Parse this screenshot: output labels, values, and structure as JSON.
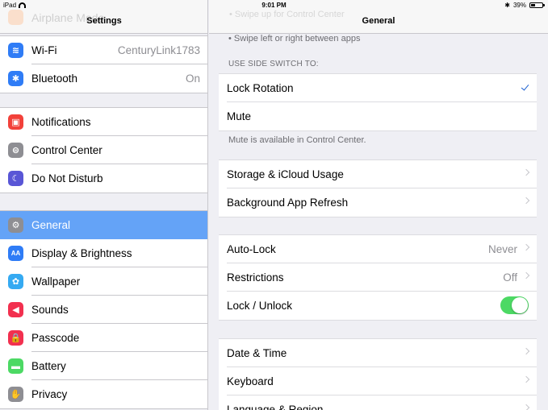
{
  "status_bar": {
    "carrier": "iPad",
    "time": "9:01 PM",
    "bluetooth_symbol": "✱",
    "battery_text": "39%",
    "battery_level": 0.39
  },
  "left": {
    "title": "Settings",
    "ghost_item": "Airplane Mode",
    "groups": [
      [
        {
          "label": "Wi-Fi",
          "value": "CenturyLink1783",
          "icon": "wifi-icon",
          "color": "#2f7cf6",
          "glyph": "≋"
        },
        {
          "label": "Bluetooth",
          "value": "On",
          "icon": "bluetooth-icon",
          "color": "#2f7cf6",
          "glyph": "✱"
        }
      ],
      [
        {
          "label": "Notifications",
          "value": "",
          "icon": "notifications-icon",
          "color": "#f2413a",
          "glyph": "▣"
        },
        {
          "label": "Control Center",
          "value": "",
          "icon": "control-center-icon",
          "color": "#8e8e93",
          "glyph": "⊜"
        },
        {
          "label": "Do Not Disturb",
          "value": "",
          "icon": "moon-icon",
          "color": "#5956d6",
          "glyph": "☾"
        }
      ],
      [
        {
          "label": "General",
          "value": "",
          "icon": "gear-icon",
          "color": "#8e8e93",
          "glyph": "⚙",
          "selected": true
        },
        {
          "label": "Display & Brightness",
          "value": "",
          "icon": "display-icon",
          "color": "#2f7cf6",
          "glyph": "AA"
        },
        {
          "label": "Wallpaper",
          "value": "",
          "icon": "wallpaper-icon",
          "color": "#35aaf2",
          "glyph": "✿"
        },
        {
          "label": "Sounds",
          "value": "",
          "icon": "sounds-icon",
          "color": "#f2304f",
          "glyph": "◀"
        },
        {
          "label": "Passcode",
          "value": "",
          "icon": "lock-icon",
          "color": "#f2304f",
          "glyph": "🔒"
        },
        {
          "label": "Battery",
          "value": "",
          "icon": "battery-icon",
          "color": "#4cd964",
          "glyph": "▬"
        },
        {
          "label": "Privacy",
          "value": "",
          "icon": "hand-icon",
          "color": "#8e8e93",
          "glyph": "✋"
        }
      ]
    ]
  },
  "right": {
    "title": "General",
    "ghost_text": "• Swipe up for Control Center",
    "swipe_note": "• Swipe left or right between apps",
    "side_switch_header": "USE SIDE SWITCH TO:",
    "side_switch_rows": [
      {
        "label": "Lock Rotation",
        "checked": true
      },
      {
        "label": "Mute",
        "checked": false
      }
    ],
    "mute_note": "Mute is available in Control Center.",
    "group2": [
      {
        "label": "Storage & iCloud Usage",
        "value": ""
      },
      {
        "label": "Background App Refresh",
        "value": ""
      }
    ],
    "group3": [
      {
        "label": "Auto-Lock",
        "value": "Never",
        "chevron": true
      },
      {
        "label": "Restrictions",
        "value": "Off",
        "chevron": true
      },
      {
        "label": "Lock / Unlock",
        "value": "",
        "toggle": true,
        "toggle_on": true
      }
    ],
    "group4": [
      {
        "label": "Date & Time",
        "value": ""
      },
      {
        "label": "Keyboard",
        "value": ""
      },
      {
        "label": "Language & Region",
        "value": ""
      }
    ]
  }
}
